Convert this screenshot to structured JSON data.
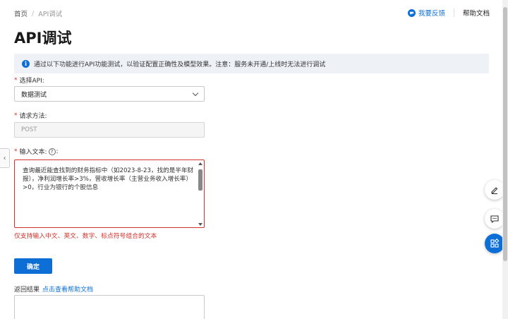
{
  "breadcrumb": {
    "home": "首页",
    "current": "API调试"
  },
  "header": {
    "feedback": "我要反馈",
    "docs": "帮助文档"
  },
  "page": {
    "title": "API调试"
  },
  "notice": {
    "text": "通过以下功能进行API功能测试，以验证配置正确性及模型效果。注意：服务未开通/上线时无法进行调试"
  },
  "form": {
    "api_label": "选择API:",
    "api_value": "数据测试",
    "method_label": "请求方法:",
    "method_value": "POST",
    "text_label_prefix": "输入文本:",
    "text_label_suffix": ":",
    "text_value": "查询最近能查找到的财务指标中（如2023-8-23，找的是半年财报），净利润增长率>3%，营收增长率（主营业务收入增长率）>0，行业为银行的个股信息",
    "error": "仅支持输入中文、英文、数字、标点符号组合的文本",
    "confirm_label": "确定",
    "result_label": "返回结果",
    "result_link": "点击查看帮助文档"
  },
  "icons": {
    "feedback": "feedback-icon",
    "info": "info-icon",
    "collapse": "chevron-left-icon",
    "edit": "edit-icon",
    "chat": "chat-icon",
    "apps": "apps-icon"
  },
  "colors": {
    "accent": "#0d6fd6",
    "error": "#d0302b"
  }
}
